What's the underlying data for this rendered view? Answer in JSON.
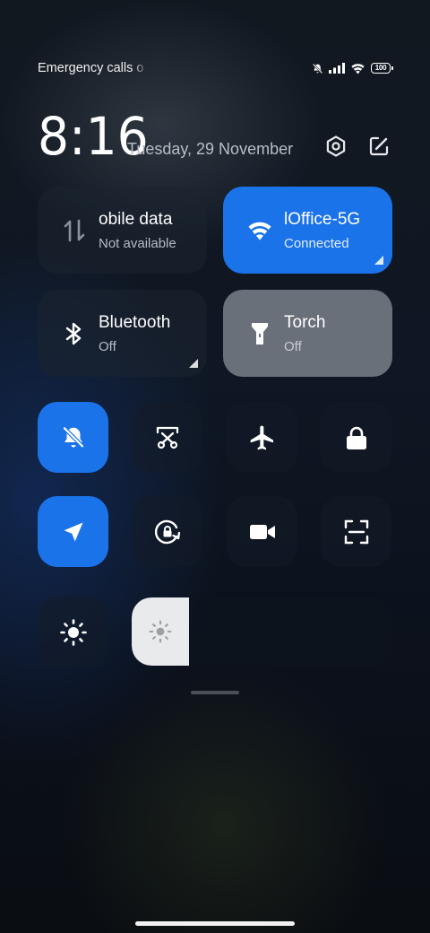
{
  "status_bar": {
    "carrier_text": "Emergency calls o",
    "icons": [
      "mute-notifications-icon",
      "signal-icon",
      "wifi-icon",
      "battery-icon"
    ],
    "battery_level": "100"
  },
  "header": {
    "time": "8:16",
    "date": "Tuesday, 29 November",
    "actions": [
      "settings-icon",
      "edit-icon"
    ]
  },
  "tiles": {
    "mobile_data": {
      "title": "Mobile data",
      "visible_title": "obile data",
      "subtitle": "Not available",
      "icon": "data-arrows-icon",
      "state": "off"
    },
    "wifi": {
      "title": "Office-5G",
      "visible_title": "lOffice-5G",
      "subtitle": "Connected",
      "icon": "wifi-icon",
      "state": "on"
    },
    "bluetooth": {
      "title": "Bluetooth",
      "subtitle": "Off",
      "icon": "bluetooth-icon",
      "state": "off"
    },
    "torch": {
      "title": "Torch",
      "subtitle": "Off",
      "icon": "torch-icon",
      "state": "off"
    }
  },
  "toggles": [
    {
      "name": "silent",
      "icon": "bell-off-icon",
      "state": "on"
    },
    {
      "name": "screenshot",
      "icon": "scissors-icon",
      "state": "off"
    },
    {
      "name": "airplane-mode",
      "icon": "airplane-icon",
      "state": "off"
    },
    {
      "name": "lock-screen",
      "icon": "lock-icon",
      "state": "off"
    },
    {
      "name": "location",
      "icon": "location-arrow-icon",
      "state": "on"
    },
    {
      "name": "rotation-lock",
      "icon": "rotate-lock-icon",
      "state": "off"
    },
    {
      "name": "screen-recorder",
      "icon": "video-camera-icon",
      "state": "off"
    },
    {
      "name": "scanner",
      "icon": "scan-frame-icon",
      "state": "off"
    }
  ],
  "brightness": {
    "icon": "sun-icon",
    "level": 0.22
  },
  "colors": {
    "accent_blue": "#1a73e8",
    "tile_off": "#1c2430",
    "torch_tile": "#6a707a",
    "brightness_fill": "#e9eaec"
  }
}
